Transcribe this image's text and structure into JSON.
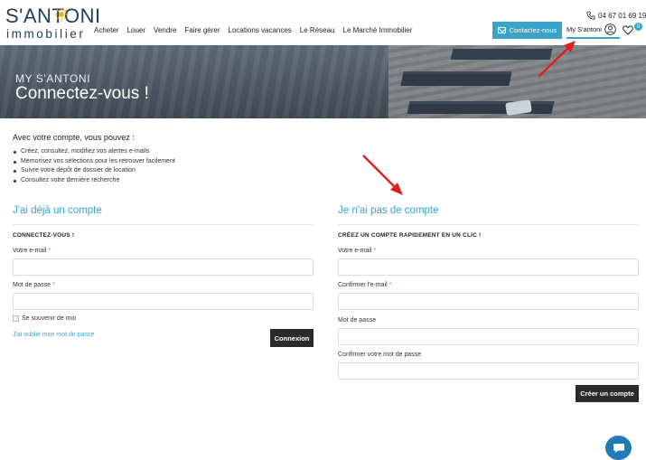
{
  "logo": {
    "top": "S'ANTONI",
    "bottom": "immobilier"
  },
  "nav": [
    "Acheter",
    "Louer",
    "Vendre",
    "Faire gérer",
    "Locations vacances",
    "Le Réseau",
    "Le Marché Immobilier"
  ],
  "header": {
    "phone": "04 67 01 69 19",
    "contact_label": "Contactez-nous",
    "account_label": "My S'antoni",
    "favorites_count": "0"
  },
  "hero": {
    "subtitle": "MY S'ANTONI",
    "title": "Connectez-vous !"
  },
  "intro": {
    "title": "Avec votre compte, vous pouvez :",
    "items": [
      "Créez, consultez, modifiez vos alertes e-mails",
      "Mémorisez vos sélections pour les retrouver facilement",
      "Suivre votre dépôt de dossier de location",
      "Consultez votre dernière recherche"
    ]
  },
  "login": {
    "title": "J'ai déjà un compte",
    "subtitle": "CONNECTEZ-VOUS !",
    "email_label": "Votre e-mail",
    "password_label": "Mot de passe",
    "remember_label": "Se souvenir de moi",
    "forgot_label": "J'ai oublié mon mot de passe",
    "submit_label": "Connexion"
  },
  "register": {
    "title": "Je n'ai pas de compte",
    "subtitle": "CRÉEZ UN COMPTE RAPIDEMENT EN UN CLIC !",
    "email_label": "Votre e-mail",
    "confirm_email_label": "Confirmer l'e-mail",
    "password_label": "Mot de passe",
    "confirm_password_label": "Confirmer votre mot de passe",
    "submit_label": "Créer un compte"
  },
  "required_mark": "*",
  "colors": {
    "accent": "#3aa3c9",
    "dark_button": "#2b2b2b",
    "brand_navy": "#1f3d55",
    "arrow": "#e02020",
    "chat": "#1f7ab8"
  }
}
